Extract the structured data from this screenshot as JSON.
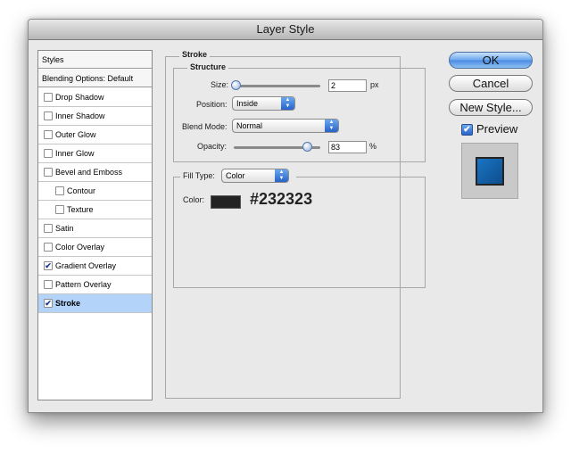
{
  "window": {
    "title": "Layer Style"
  },
  "styles_panel": {
    "header": "Styles",
    "blending": "Blending Options: Default",
    "items": [
      {
        "label": "Drop Shadow",
        "checked": false,
        "indent": false,
        "selected": false
      },
      {
        "label": "Inner Shadow",
        "checked": false,
        "indent": false,
        "selected": false
      },
      {
        "label": "Outer Glow",
        "checked": false,
        "indent": false,
        "selected": false
      },
      {
        "label": "Inner Glow",
        "checked": false,
        "indent": false,
        "selected": false
      },
      {
        "label": "Bevel and Emboss",
        "checked": false,
        "indent": false,
        "selected": false
      },
      {
        "label": "Contour",
        "checked": false,
        "indent": true,
        "selected": false
      },
      {
        "label": "Texture",
        "checked": false,
        "indent": true,
        "selected": false
      },
      {
        "label": "Satin",
        "checked": false,
        "indent": false,
        "selected": false
      },
      {
        "label": "Color Overlay",
        "checked": false,
        "indent": false,
        "selected": false
      },
      {
        "label": "Gradient Overlay",
        "checked": true,
        "indent": false,
        "selected": false
      },
      {
        "label": "Pattern Overlay",
        "checked": false,
        "indent": false,
        "selected": false
      },
      {
        "label": "Stroke",
        "checked": true,
        "indent": false,
        "selected": true
      }
    ]
  },
  "stroke": {
    "title": "Stroke",
    "structure_title": "Structure",
    "size_label": "Size:",
    "size_value": "2",
    "size_unit": "px",
    "size_level": 0.01,
    "position_label": "Position:",
    "position_value": "Inside",
    "blend_label": "Blend Mode:",
    "blend_value": "Normal",
    "opacity_label": "Opacity:",
    "opacity_value": "83",
    "opacity_unit": "%",
    "opacity_level": 0.83,
    "fill_type_label": "Fill Type:",
    "fill_type_value": "Color",
    "color_label": "Color:",
    "color_hex": "#232323",
    "color_swatch": "#232323"
  },
  "buttons": {
    "ok": "OK",
    "cancel": "Cancel",
    "new_style": "New Style...",
    "preview": "Preview",
    "preview_checked": true
  },
  "colors": {
    "accent": "#4a8be2",
    "selection": "#b3d3f9",
    "preview_fill": "#1b74c4"
  }
}
